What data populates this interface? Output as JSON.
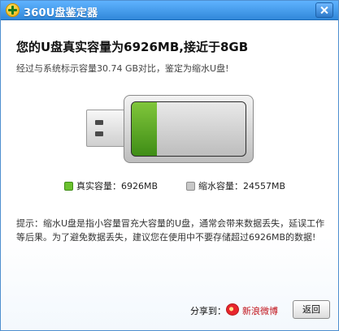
{
  "window": {
    "title": "360U盘鉴定器"
  },
  "result": {
    "headline": "您的U盘真实容量为6926MB,接近于8GB",
    "subline": "经过与系统标示容量30.74 GB对比，鉴定为缩水U盘!"
  },
  "gauge": {
    "real_fraction": 0.22
  },
  "legend": {
    "real_label": "真实容量：6926MB",
    "shrink_label": "缩水容量：24557MB"
  },
  "tip": "提示：缩水U盘是指小容量冒充大容量的U盘，通常会带来数据丢失，延误工作等后果。为了避免数据丢失，建议您在使用中不要存储超过6926MB的数据!",
  "footer": {
    "share_label": "分享到：",
    "weibo_label": "新浪微博",
    "back_label": "返回"
  },
  "icons": {
    "app": "app-plus-icon",
    "close": "close-icon",
    "weibo": "weibo-icon"
  }
}
